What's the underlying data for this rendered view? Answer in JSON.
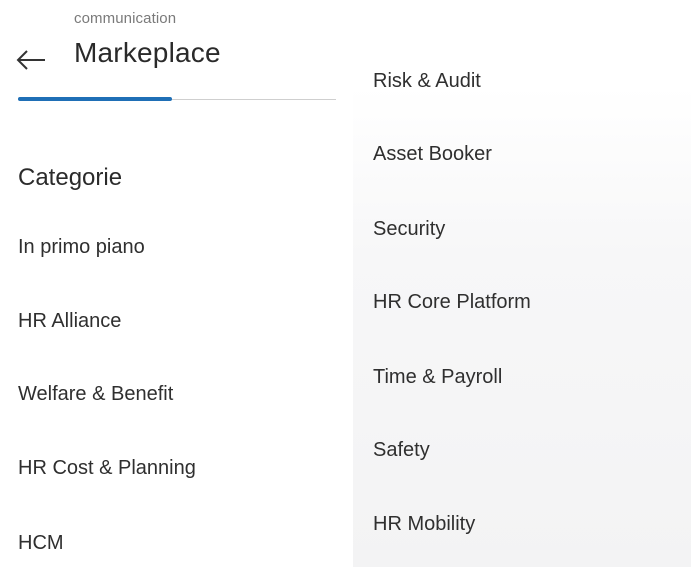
{
  "header": {
    "overline": "communication",
    "title": "Markeplace"
  },
  "categories": {
    "heading": "Categorie",
    "left_items": [
      {
        "label": "In primo piano"
      },
      {
        "label": "HR Alliance"
      },
      {
        "label": "Welfare & Benefit"
      },
      {
        "label": "HR Cost & Planning"
      },
      {
        "label": "HCM"
      }
    ],
    "right_items": [
      {
        "label": "Risk & Audit"
      },
      {
        "label": "Asset Booker"
      },
      {
        "label": "Security"
      },
      {
        "label": "HR Core Platform"
      },
      {
        "label": "Time & Payroll"
      },
      {
        "label": "Safety"
      },
      {
        "label": "HR Mobility"
      }
    ]
  },
  "icons": {
    "back": "arrow-left-icon"
  },
  "colors": {
    "accent": "#1f6fb6",
    "text": "#2b2b2b",
    "muted": "#7a7a7a"
  }
}
